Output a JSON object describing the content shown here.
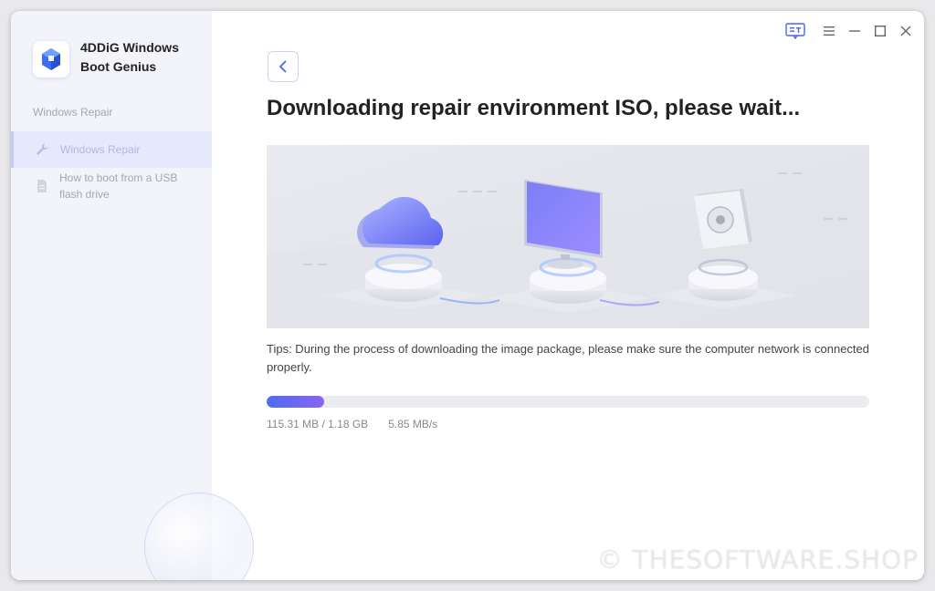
{
  "app": {
    "title_line1": "4DDiG Windows",
    "title_line2": "Boot Genius"
  },
  "sidebar": {
    "section_label": "Windows Repair",
    "items": [
      {
        "label": "Windows Repair",
        "icon": "wrench-icon",
        "active": true
      },
      {
        "label": "How to boot from a USB flash drive",
        "icon": "document-icon",
        "active": false
      }
    ]
  },
  "titlebar": {
    "buttons": [
      "feedback-icon",
      "menu-icon",
      "minimize-icon",
      "maximize-icon",
      "close-icon"
    ]
  },
  "main": {
    "heading": "Downloading repair environment ISO, please wait...",
    "tips": "Tips: During the process of downloading the image package, please make sure the computer network is connected properly.",
    "progress": {
      "fraction": 0.0954,
      "downloaded": "115.31 MB / 1.18 GB",
      "speed": "5.85 MB/s"
    }
  },
  "colors": {
    "accent": "#5a6df0",
    "sidebar_bg": "#f3f4f9",
    "active_item_bg": "#e6e9fb"
  },
  "watermark": "© THESOFTWARE.SHOP"
}
